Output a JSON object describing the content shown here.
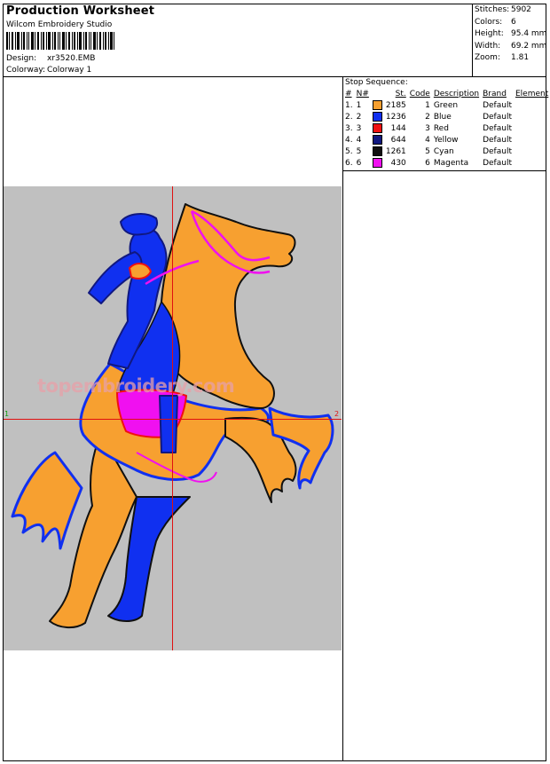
{
  "header": {
    "title": "Production Worksheet",
    "company": "Wilcom Embroidery Studio",
    "design_label": "Design:",
    "design_value": "xr3520.EMB",
    "colorway_label": "Colorway:",
    "colorway_value": "Colorway 1"
  },
  "stats": [
    {
      "label": "Stitches:",
      "value": "5902"
    },
    {
      "label": "Colors:",
      "value": "6"
    },
    {
      "label": "Height:",
      "value": "95.4 mm"
    },
    {
      "label": "Width:",
      "value": "69.2 mm"
    },
    {
      "label": "Zoom:",
      "value": "1.81"
    }
  ],
  "stop_sequence": {
    "title": "Stop Sequence:",
    "headers": [
      "#",
      "N#",
      "St.",
      "Code",
      "Description",
      "Brand",
      "Element"
    ],
    "rows": [
      {
        "n": "1.",
        "nn": "1",
        "color": "#f7a030",
        "st": "2185",
        "code": "1",
        "desc": "Green",
        "brand": "Default"
      },
      {
        "n": "2.",
        "nn": "2",
        "color": "#1030f0",
        "st": "1236",
        "code": "2",
        "desc": "Blue",
        "brand": "Default"
      },
      {
        "n": "3.",
        "nn": "3",
        "color": "#f01010",
        "st": "144",
        "code": "3",
        "desc": "Red",
        "brand": "Default"
      },
      {
        "n": "4.",
        "nn": "4",
        "color": "#101880",
        "st": "644",
        "code": "4",
        "desc": "Yellow",
        "brand": "Default"
      },
      {
        "n": "5.",
        "nn": "5",
        "color": "#101010",
        "st": "1261",
        "code": "5",
        "desc": "Cyan",
        "brand": "Default"
      },
      {
        "n": "6.",
        "nn": "6",
        "color": "#f010f0",
        "st": "430",
        "code": "6",
        "desc": "Magenta",
        "brand": "Default"
      }
    ]
  },
  "design_view": {
    "watermark": "topembroidery.com",
    "axis_left": "1",
    "axis_right": "2",
    "bg_color": "#c0c0c0",
    "crosshair_color": "#e01010"
  }
}
